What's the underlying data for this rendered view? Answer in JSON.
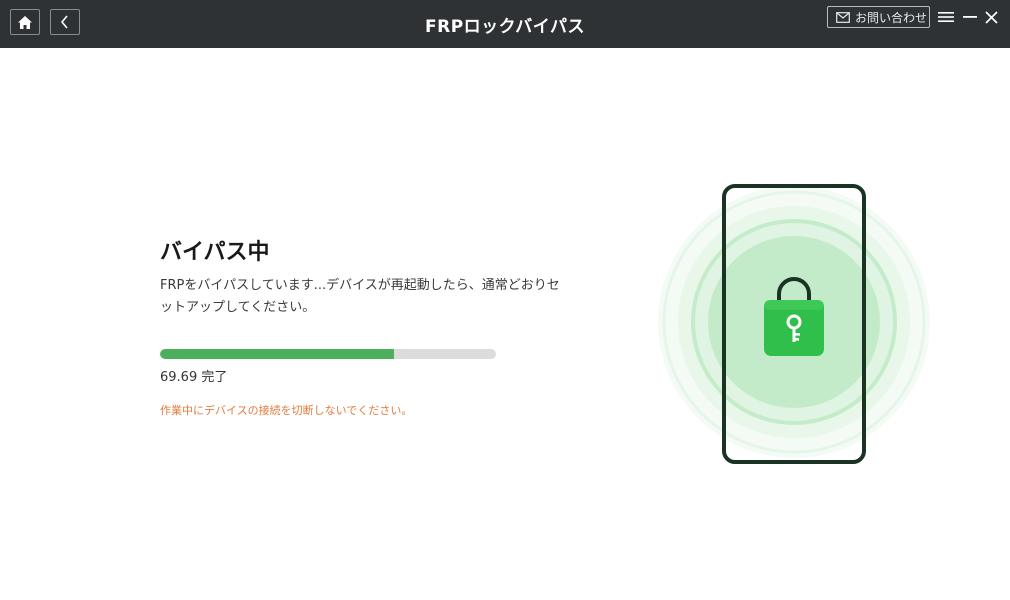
{
  "titlebar": {
    "title": "FRPロックバイパス",
    "contact_label": "お問い合わせ",
    "icons": {
      "home": "home-icon",
      "back": "chevron-left-icon",
      "contact": "mail-icon",
      "menu": "hamburger-menu-icon",
      "minimize": "minimize-icon",
      "close": "close-icon"
    }
  },
  "main": {
    "heading": "バイパス中",
    "description": "FRPをバイパスしています...デバイスが再起動したら、通常どおりセットアップしてください。",
    "progress": {
      "percent": 69.69,
      "text": "69.69 完了"
    },
    "warning": "作業中にデバイスの接続を切断しないでください。"
  },
  "illustration": {
    "icon": "phone-with-padlock-key-icon"
  },
  "colors": {
    "titlebar_bg": "#2f3235",
    "progress_fill": "#4caf5c",
    "progress_track": "#dcdcdc",
    "warning_text": "#e07d3c",
    "lock_green": "#2fbf4a"
  }
}
